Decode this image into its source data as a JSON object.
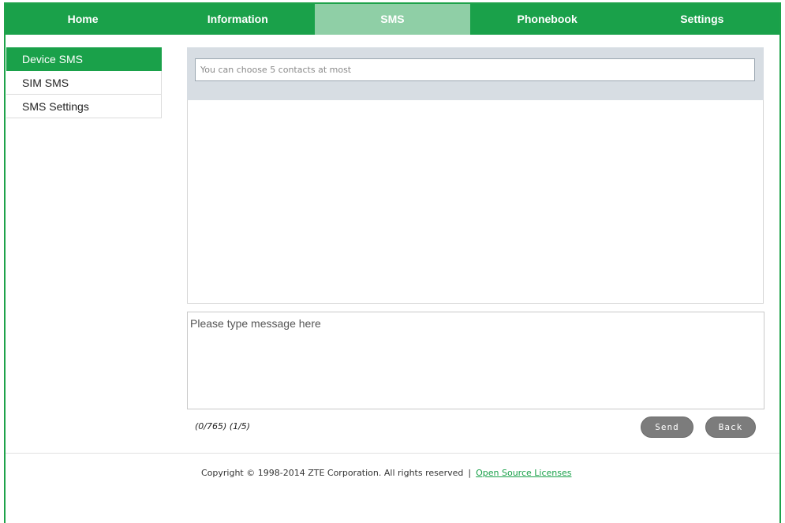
{
  "nav": {
    "tabs": [
      {
        "label": "Home"
      },
      {
        "label": "Information"
      },
      {
        "label": "SMS"
      },
      {
        "label": "Phonebook"
      },
      {
        "label": "Settings"
      }
    ],
    "active": "SMS"
  },
  "sidebar": {
    "items": [
      {
        "label": "Device SMS"
      },
      {
        "label": "SIM SMS"
      },
      {
        "label": "SMS Settings"
      }
    ],
    "active": "Device SMS"
  },
  "compose": {
    "recipient_placeholder": "You can choose 5 contacts at most",
    "message_placeholder": "Please type message here",
    "counter": "(0/765) (1/5)",
    "send_label": "Send",
    "back_label": "Back"
  },
  "footer": {
    "copyright": "Copyright © 1998-2014 ZTE Corporation. All rights reserved",
    "separator": "|",
    "license_link": "Open Source Licenses"
  },
  "colors": {
    "brand_green": "#1aa14a",
    "active_tab": "#8fcfa6",
    "button_gray": "#7c7c7c"
  }
}
